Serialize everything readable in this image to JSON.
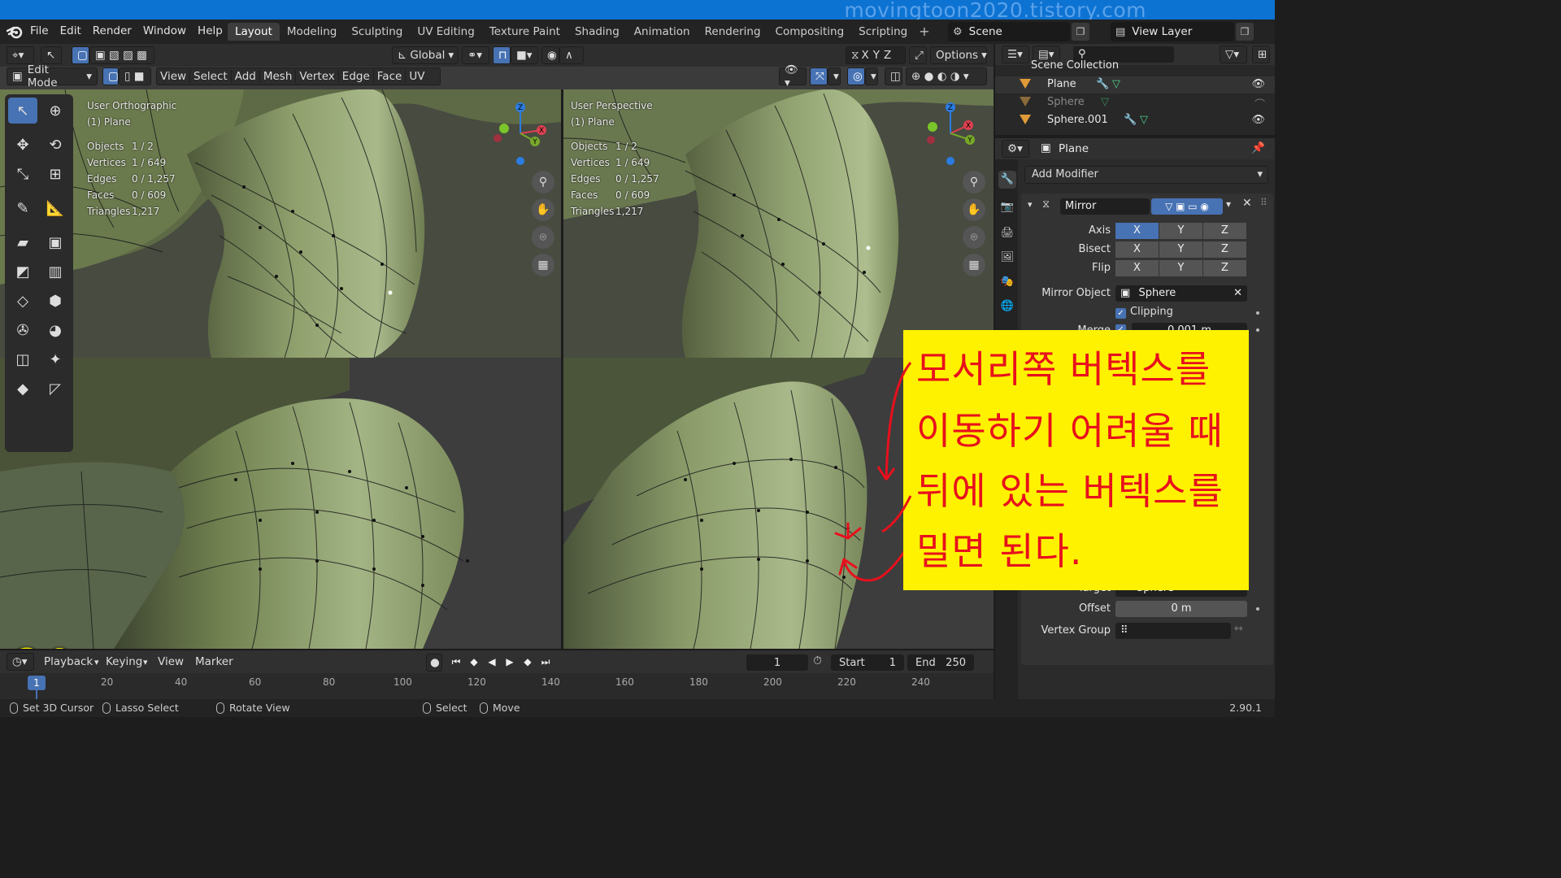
{
  "watermark": "movingtoon2020.tistory.com",
  "menu": [
    "File",
    "Edit",
    "Render",
    "Window",
    "Help"
  ],
  "workspace_tabs": [
    "Layout",
    "Modeling",
    "Sculpting",
    "UV Editing",
    "Texture Paint",
    "Shading",
    "Animation",
    "Rendering",
    "Compositing",
    "Scripting"
  ],
  "active_tab": "Layout",
  "scene": "Scene",
  "view_layer": "View Layer",
  "header": {
    "transform_orientation": "Global",
    "options": "Options",
    "axis_toggles": [
      "X",
      "Y",
      "Z"
    ],
    "mode": "Edit Mode",
    "edit_menus": [
      "View",
      "Select",
      "Add",
      "Mesh",
      "Vertex",
      "Edge",
      "Face",
      "UV"
    ]
  },
  "viewport_left": {
    "view": "User Orthographic",
    "object": "(1) Plane",
    "stats": [
      {
        "k": "Objects",
        "v": "1 / 2"
      },
      {
        "k": "Vertices",
        "v": "1 / 649"
      },
      {
        "k": "Edges",
        "v": "0 / 1,257"
      },
      {
        "k": "Faces",
        "v": "0 / 609"
      },
      {
        "k": "Triangles",
        "v": "1,217"
      }
    ]
  },
  "viewport_right": {
    "view": "User Perspective",
    "object": "(1) Plane",
    "stats": [
      {
        "k": "Objects",
        "v": "1 / 2"
      },
      {
        "k": "Vertices",
        "v": "1 / 649"
      },
      {
        "k": "Edges",
        "v": "0 / 1,257"
      },
      {
        "k": "Faces",
        "v": "0 / 609"
      },
      {
        "k": "Triangles",
        "v": "1,217"
      }
    ]
  },
  "gizmo_axes": {
    "x": "X",
    "y": "Y",
    "z": "Z"
  },
  "timeline": {
    "menus": [
      "Playback",
      "Keying",
      "View",
      "Marker"
    ],
    "current_frame": "1",
    "start_label": "Start",
    "start": "1",
    "end_label": "End",
    "end": "250",
    "ruler_current": "1",
    "ticks": [
      "20",
      "40",
      "60",
      "80",
      "100",
      "120",
      "140",
      "160",
      "180",
      "200",
      "220",
      "240"
    ]
  },
  "statusbar": {
    "set_cursor": "Set 3D Cursor",
    "lasso": "Lasso Select",
    "rotate": "Rotate View",
    "select": "Select",
    "move": "Move",
    "version": "2.90.1"
  },
  "outliner": {
    "collection": "Scene Collection",
    "items": [
      "Plane",
      "Sphere",
      "Sphere.001"
    ]
  },
  "properties": {
    "object": "Plane",
    "add_modifier": "Add Modifier",
    "modifier_name": "Mirror",
    "axis_label": "Axis",
    "bisect_label": "Bisect",
    "flip_label": "Flip",
    "xyz": [
      "X",
      "Y",
      "Z"
    ],
    "mirror_object_label": "Mirror Object",
    "mirror_object": "Sphere",
    "clipping": "Clipping",
    "merge_label": "Merge",
    "merge_value": "0.001 m",
    "target_label": "Target",
    "target_value": "Sphere",
    "offset_label": "Offset",
    "offset_value": "0 m",
    "vertex_group_label": "Vertex Group"
  },
  "annotation": {
    "lines": [
      "모서리쪽 버텍스를",
      "이동하기 어려울 때",
      "뒤에 있는 버텍스를",
      "밀면 된다."
    ],
    "frame_number": "20"
  },
  "colors": {
    "mesh": "#8ea06e",
    "accent": "#4772b3",
    "note_bg": "#fff200",
    "note_text": "#e8101c"
  }
}
